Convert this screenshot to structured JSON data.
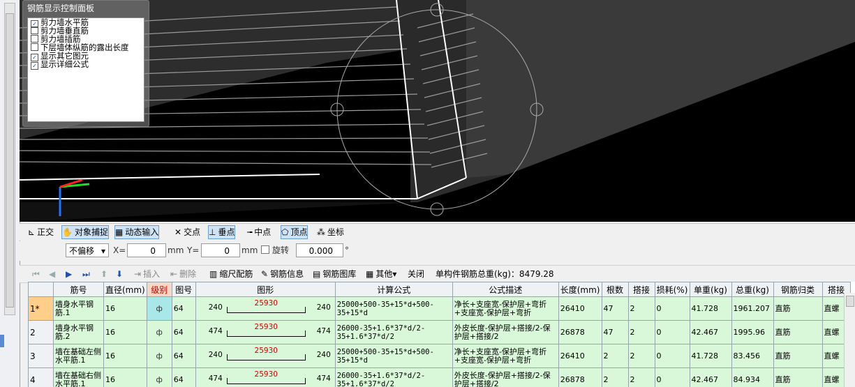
{
  "control_panel": {
    "title": "钢筋显示控制面板",
    "options": [
      {
        "label": "剪力墙水平筋",
        "checked": true
      },
      {
        "label": "剪力墙垂直筋",
        "checked": false
      },
      {
        "label": "剪力墙插筋",
        "checked": false
      },
      {
        "label": "下层墙体纵筋的露出长度",
        "checked": false
      },
      {
        "label": "显示其它图元",
        "checked": true
      },
      {
        "label": "显示详细公式",
        "checked": true
      }
    ]
  },
  "snap_toolbar": {
    "ortho": "正交",
    "object_snap": "对象捕捉",
    "dynamic_input": "动态输入",
    "intersection": "交点",
    "perpendicular": "垂点",
    "midpoint": "中点",
    "vertex": "顶点",
    "coordinate": "坐标"
  },
  "offset_bar": {
    "offset_mode": "不偏移",
    "x_label": "X=",
    "x_value": "0",
    "unit1": "mm",
    "y_label": "Y=",
    "y_value": "0",
    "unit2": "mm",
    "rotate_label": "旋转",
    "rotate_value": "0.000",
    "degree": "°"
  },
  "grid_toolbar": {
    "insert": "插入",
    "delete": "删除",
    "scale_rebar": "缩尺配筋",
    "rebar_info": "钢筋信息",
    "rebar_library": "钢筋图库",
    "other": "其他",
    "close": "关闭",
    "total_label": "单构件钢筋总重(kg)：8479.28"
  },
  "table": {
    "headers": [
      "筋号",
      "直径(mm)",
      "级别",
      "图号",
      "图形",
      "计算公式",
      "公式描述",
      "长度(mm)",
      "根数",
      "搭接",
      "损耗(%)",
      "单重(kg)",
      "总重(kg)",
      "钢筋归类",
      "搭接"
    ],
    "rows": [
      {
        "num": "1*",
        "name": "墙身水平钢筋.1",
        "dia": "16",
        "grade": "ф",
        "fig": "64",
        "left": "240",
        "mid": "25930",
        "right": "240",
        "formula": "25000+500-35+15*d+500-35+15*d",
        "desc": "净长+支座宽-保护层+弯折+支座宽-保护层+弯折",
        "length": "26410",
        "count": "47",
        "lap": "2",
        "loss": "0",
        "unit_w": "41.728",
        "total_w": "1961.207",
        "category": "直筋",
        "lap2": "直螺"
      },
      {
        "num": "2",
        "name": "墙身水平钢筋.2",
        "dia": "16",
        "grade": "ф",
        "fig": "64",
        "left": "474",
        "mid": "25930",
        "right": "474",
        "formula": "26000-35+1.6*37*d/2-35+1.6*37*d/2",
        "desc": "外皮长度-保护层+搭接/2-保护层+搭接/2",
        "length": "26878",
        "count": "47",
        "lap": "2",
        "loss": "0",
        "unit_w": "42.467",
        "total_w": "1995.96",
        "category": "直筋",
        "lap2": "直螺"
      },
      {
        "num": "3",
        "name": "墙在基础左侧水平筋.1",
        "dia": "16",
        "grade": "ф",
        "fig": "64",
        "left": "240",
        "mid": "25930",
        "right": "240",
        "formula": "25000+500-35+15*d+500-35+15*d",
        "desc": "净长+支座宽-保护层+弯折+支座宽-保护层+弯折",
        "length": "26410",
        "count": "2",
        "lap": "2",
        "loss": "0",
        "unit_w": "41.728",
        "total_w": "83.456",
        "category": "直筋",
        "lap2": "直螺"
      },
      {
        "num": "4",
        "name": "墙在基础右侧水平筋.1",
        "dia": "16",
        "grade": "ф",
        "fig": "64",
        "left": "474",
        "mid": "25930",
        "right": "474",
        "formula": "26000-35+1.6*37*d/2-35+1.6*37*d/2",
        "desc": "外皮长度-保护层+搭接/2-保护层+搭接/2",
        "length": "26878",
        "count": "2",
        "lap": "2",
        "loss": "0",
        "unit_w": "42.467",
        "total_w": "84.934",
        "category": "直筋",
        "lap2": "直螺"
      }
    ]
  }
}
